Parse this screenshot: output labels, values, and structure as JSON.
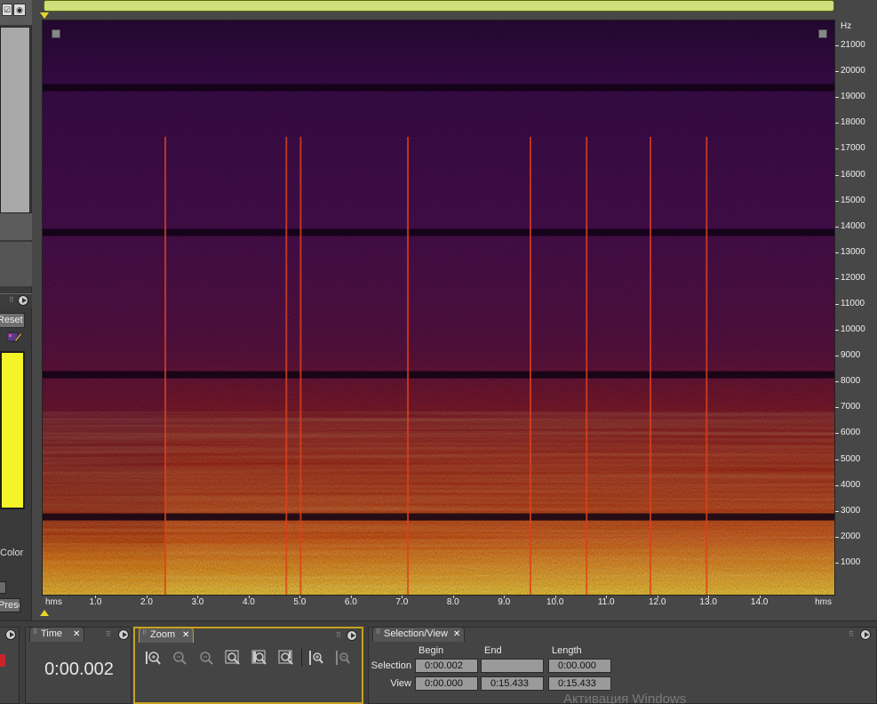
{
  "colors": {
    "accent": "#c8a020",
    "scrollbar": "#cfe07a",
    "swatch": "#f3f528",
    "playhead": "#e8d52a"
  },
  "left_panel": {
    "reset_label": "Reset",
    "color_label": "Color",
    "bottom_button_label": "Presets..."
  },
  "spectrogram": {
    "freq_unit": "Hz",
    "freq_ticks": [
      "21000",
      "20000",
      "19000",
      "18000",
      "17000",
      "16000",
      "15000",
      "14000",
      "13000",
      "12000",
      "11000",
      "10000",
      "9000",
      "8000",
      "7000",
      "6000",
      "5000",
      "4000",
      "3000",
      "2000",
      "1000"
    ],
    "freq_max": 22000,
    "time_unit_left": "hms",
    "time_unit_right": "hms",
    "time_ticks": [
      "1.0",
      "2.0",
      "3.0",
      "4.0",
      "5.0",
      "6.0",
      "7.0",
      "8.0",
      "9.0",
      "10.0",
      "11.0",
      "12.0",
      "13.0",
      "14.0"
    ],
    "time_range": [
      0,
      15.433
    ],
    "transients_s": [
      2.35,
      4.72,
      5.0,
      7.1,
      9.5,
      10.6,
      11.85,
      12.95
    ],
    "dark_bands_hz": [
      19400,
      13800,
      8300,
      2800
    ]
  },
  "time_panel": {
    "tab_label": "Time",
    "value": "0:00.002"
  },
  "zoom_panel": {
    "tab_label": "Zoom",
    "buttons": [
      "zoom-in-amplitude-icon",
      "zoom-out-amplitude-icon",
      "zoom-out-full-icon",
      "zoom-to-selection-icon",
      "zoom-in-left-icon",
      "zoom-in-right-icon",
      "zoom-in-vertical-icon",
      "zoom-out-vertical-icon"
    ]
  },
  "selection_panel": {
    "tab_label": "Selection/View",
    "col_begin": "Begin",
    "col_end": "End",
    "col_length": "Length",
    "row_selection": "Selection",
    "row_view": "View",
    "selection_begin": "0:00.002",
    "selection_end": "",
    "selection_length": "0:00.000",
    "view_begin": "0:00.000",
    "view_end": "0:15.433",
    "view_length": "0:15.433"
  },
  "watermark": "Активация Windows"
}
